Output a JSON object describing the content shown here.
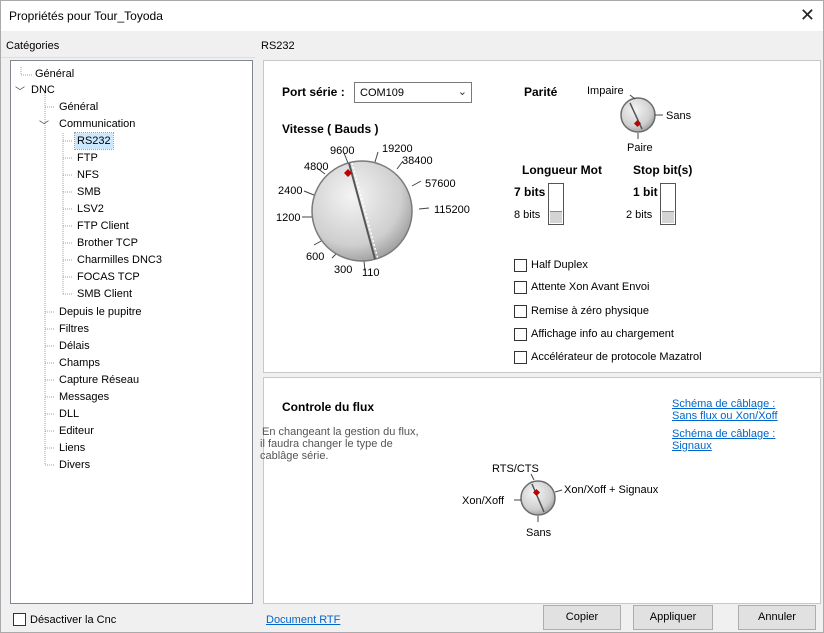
{
  "window": {
    "title": "Propriétés pour Tour_Toyoda",
    "close": "✕"
  },
  "headers": {
    "categories": "Catégories",
    "section": "RS232"
  },
  "tree": {
    "items": [
      {
        "label": "Général"
      },
      {
        "label": "DNC"
      },
      {
        "label": "Général"
      },
      {
        "label": "Communication"
      },
      {
        "label": "RS232"
      },
      {
        "label": "FTP"
      },
      {
        "label": "NFS"
      },
      {
        "label": "SMB"
      },
      {
        "label": "LSV2"
      },
      {
        "label": "FTP Client"
      },
      {
        "label": "Brother TCP"
      },
      {
        "label": "Charmilles DNC3"
      },
      {
        "label": "FOCAS TCP"
      },
      {
        "label": "SMB Client"
      },
      {
        "label": "Depuis le pupitre"
      },
      {
        "label": "Filtres"
      },
      {
        "label": "Délais"
      },
      {
        "label": "Champs"
      },
      {
        "label": "Capture Réseau"
      },
      {
        "label": "Messages"
      },
      {
        "label": "DLL"
      },
      {
        "label": "Editeur"
      },
      {
        "label": "Liens"
      },
      {
        "label": "Divers"
      }
    ]
  },
  "rs232": {
    "port_label": "Port série :",
    "port_value": "COM109",
    "vitesse_label": "Vitesse ( Bauds )",
    "speeds": [
      "110",
      "300",
      "600",
      "1200",
      "2400",
      "4800",
      "9600",
      "19200",
      "38400",
      "57600",
      "115200"
    ],
    "selected_speed": "9600",
    "parite_label": "Parité",
    "parite_options": {
      "top": "Impaire",
      "right": "Sans",
      "bottom": "Paire"
    },
    "longueur_label": "Longueur Mot",
    "longueur_top": "7 bits",
    "longueur_bottom": "8 bits",
    "stopbits_label": "Stop bit(s)",
    "stopbits_top": "1 bit",
    "stopbits_bottom": "2 bits",
    "checkboxes": [
      {
        "label": "Half Duplex",
        "checked": false
      },
      {
        "label": "Attente Xon Avant Envoi",
        "checked": false
      },
      {
        "label": "Remise à zéro physique",
        "checked": false
      },
      {
        "label": "Affichage info au chargement",
        "checked": false
      },
      {
        "label": "Accélérateur de protocole Mazatrol",
        "checked": false
      }
    ]
  },
  "flux": {
    "title": "Controle du flux",
    "description": [
      "En changeant la gestion du flux,",
      "il faudra changer le type de",
      "cablâge série."
    ],
    "link1": [
      "Schéma de câblage :",
      "Sans flux ou Xon/Xoff"
    ],
    "link2": [
      "Schéma de câblage :",
      "Signaux"
    ],
    "options": {
      "top": "RTS/CTS",
      "right": "Xon/Xoff + Signaux",
      "left": "Xon/Xoff",
      "bottom": "Sans"
    }
  },
  "footer": {
    "disable_label": "Désactiver la Cnc",
    "document_link": "Document RTF",
    "copy": "Copier",
    "apply": "Appliquer",
    "cancel": "Annuler"
  },
  "colors": {
    "accent_red": "#c00000",
    "link": "#0066cc",
    "selection": "#cce8ff"
  }
}
